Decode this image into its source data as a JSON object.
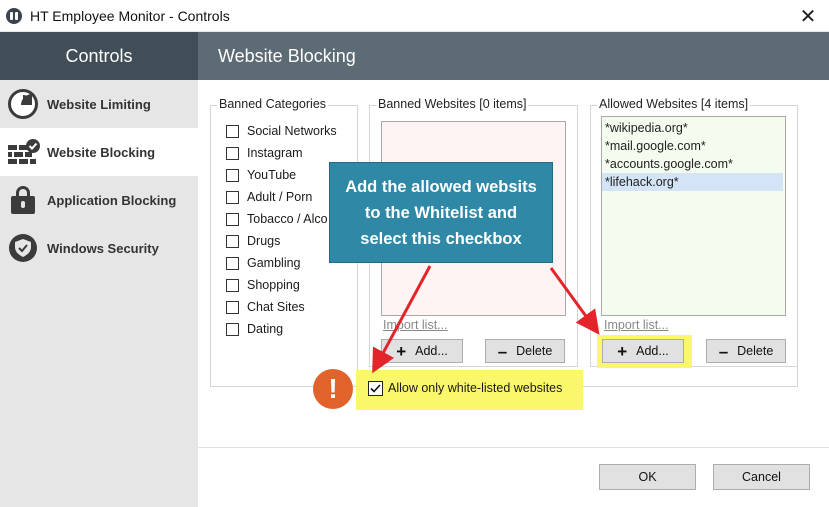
{
  "window": {
    "title": "HT Employee Monitor - Controls",
    "close_glyph": "✕"
  },
  "sidebar": {
    "header": "Controls",
    "items": [
      {
        "label": "Website Limiting",
        "icon": "gauge-icon",
        "active": false
      },
      {
        "label": "Website Blocking",
        "icon": "wall-check-icon",
        "active": true
      },
      {
        "label": "Application Blocking",
        "icon": "lock-icon",
        "active": false
      },
      {
        "label": "Windows Security",
        "icon": "shield-check-icon",
        "active": false
      }
    ]
  },
  "content": {
    "header": "Website Blocking",
    "banned_categories": {
      "label": "Banned Categories",
      "items": [
        "Social Networks",
        "Instagram",
        "YouTube",
        "Adult / Porn",
        "Tobacco / Alco",
        "Drugs",
        "Gambling",
        "Shopping",
        "Chat Sites",
        "Dating"
      ]
    },
    "banned_websites": {
      "label": "Banned Websites [0 items]",
      "items": [],
      "import_link": "Import list...",
      "add_label": "Add...",
      "delete_label": "Delete"
    },
    "allowed_websites": {
      "label": "Allowed Websites [4 items]",
      "items": [
        "*wikipedia.org*",
        "*mail.google.com*",
        "*accounts.google.com*",
        "*lifehack.org*"
      ],
      "selected_index": 3,
      "import_link": "Import list...",
      "add_label": "Add...",
      "delete_label": "Delete"
    },
    "whitelist_checkbox": {
      "label": "Allow only white-listed websites",
      "checked": true
    }
  },
  "annotation": {
    "callout_lines": [
      "Add the allowed websits",
      "to the Whitelist and",
      "select this checkbox"
    ],
    "alert_glyph": "!"
  },
  "footer": {
    "ok_label": "OK",
    "cancel_label": "Cancel"
  },
  "colors": {
    "sidebar_header": "#414e57",
    "content_header": "#5d6b74",
    "sidebar_bg": "#e6e6e6",
    "callout": "#2e88a6",
    "highlight": "#fbf76a",
    "arrow": "#e3242b",
    "alert": "#e2622c",
    "banned_list_bg": "#fff4f4",
    "allowed_list_bg": "#f4fbef"
  }
}
